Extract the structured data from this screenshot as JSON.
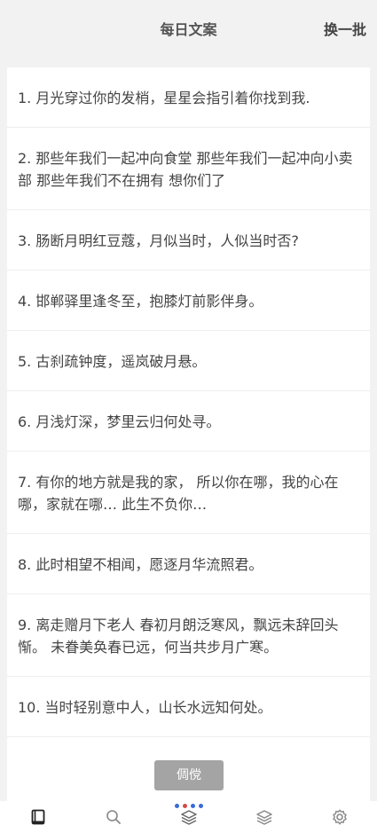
{
  "header": {
    "title": "每日文案",
    "refresh_label": "换一批"
  },
  "quotes": [
    "1. 月光穿过你的发梢，星星会指引着你找到我.",
    "2. 那些年我们一起冲向食堂 那些年我们一起冲向小卖部 那些年我们不在拥有 想你们了",
    "3. 肠断月明红豆蔻，月似当时，人似当时否?",
    "4. 邯郸驿里逢冬至，抱膝灯前影伴身。",
    "5. 古刹疏钟度，遥岚破月悬。",
    "6. 月浅灯深，梦里云归何处寻。",
    "7. 有你的地方就是我的家， 所以你在哪，我的心在哪，家就在哪… 此生不负你…",
    "8. 此时相望不相闻，愿逐月华流照君。",
    "9. 离走赠月下老人 春初月朗泛寒风，飘远未辞回头惭。 未眷美奂春已远，何当共步月广寒。",
    "10. 当时轻别意中人，山长水远知何处。"
  ],
  "toast": {
    "text": "倜傥"
  },
  "tabbar": {
    "icons": [
      "book-icon",
      "search-icon",
      "layers-icon",
      "stack-icon",
      "gear-icon"
    ],
    "loading_dot_colors": [
      "#3a6bd8",
      "#d84a4a",
      "#3a6bd8",
      "#3a6bd8"
    ]
  }
}
